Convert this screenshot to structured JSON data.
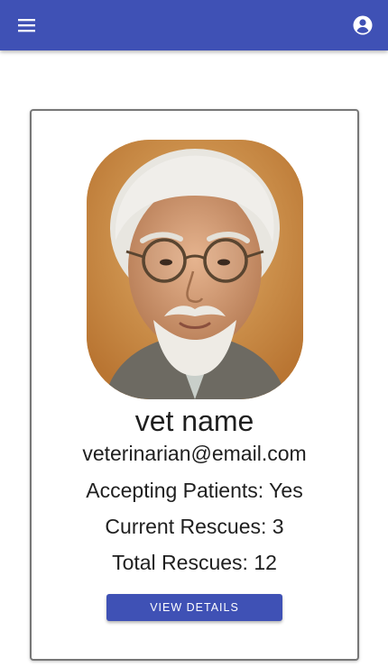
{
  "header": {
    "menu_icon": "menu-icon",
    "account_icon": "account-circle-icon",
    "color": "#3f51b5"
  },
  "profile": {
    "name": "vet name",
    "email": "veterinarian@email.com",
    "accepting_label": "Accepting Patients:",
    "accepting_value": "Yes",
    "current_label": "Current Rescues:",
    "current_value": "3",
    "total_label": "Total Rescues:",
    "total_value": "12",
    "details_button": "VIEW DETAILS"
  }
}
